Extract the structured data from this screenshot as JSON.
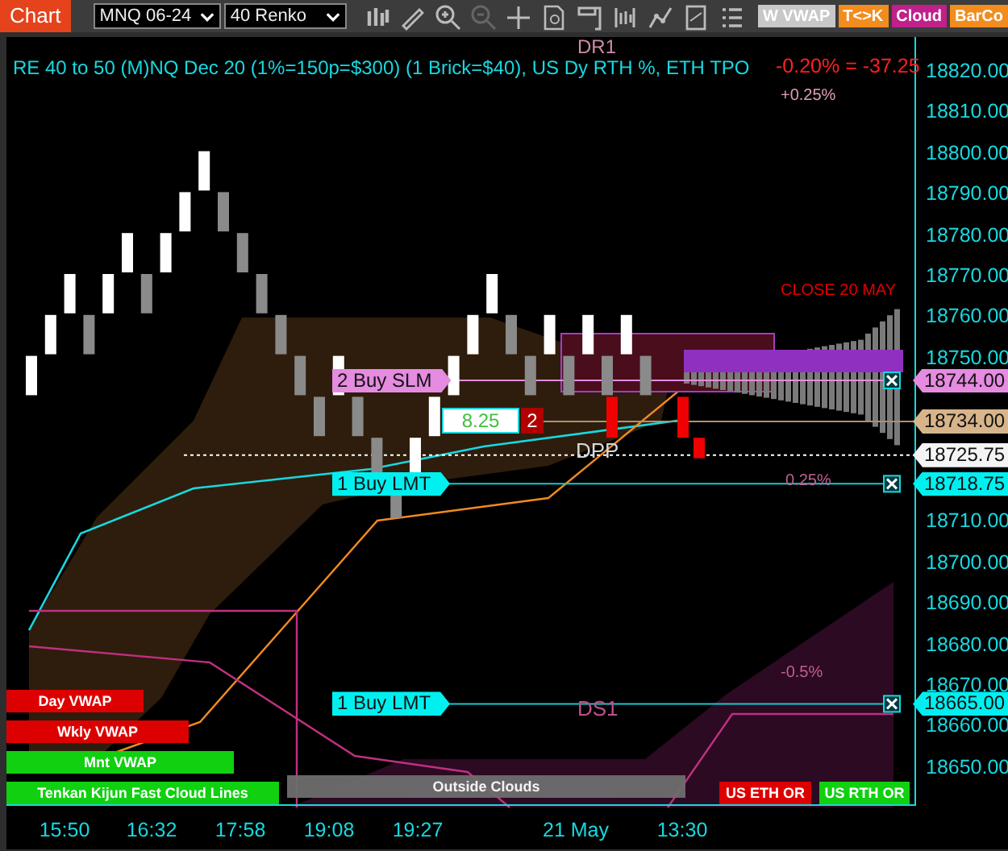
{
  "toolbar": {
    "chart_button": "Chart",
    "instrument": "MNQ 06-24",
    "bar_type": "40 Renko",
    "buttons": [
      {
        "label": "W VWAP",
        "color": "#c8c8c8"
      },
      {
        "label": "T<>K",
        "color": "#f28c1e"
      },
      {
        "label": "Cloud",
        "color": "#c0208a"
      },
      {
        "label": "BarCo",
        "color": "#f28c1e"
      }
    ]
  },
  "chart": {
    "title": "RE 40 to 50 (M)NQ Dec 20 (1%=150p=$300) (1 Brick=$40), US Dy RTH %, ETH TPO",
    "change": "-0.20% = -37.25",
    "annotations": [
      {
        "label": "DR1",
        "color": "#d08aa8"
      },
      {
        "label": "+0.25%",
        "color": "#e0a0b0"
      },
      {
        "label": "CLOSE 20 MAY",
        "color": "#e00000"
      },
      {
        "label": "DPP",
        "color": "#d8d8d8"
      },
      {
        "label": "0.25%",
        "color": "#c06090"
      },
      {
        "label": "-0.5%",
        "color": "#c06090"
      },
      {
        "label": "DS1",
        "color": "#c0508a"
      }
    ],
    "order_tags": [
      {
        "label": "2 Buy SLM",
        "color": "#e58be0"
      },
      {
        "label": "1 Buy LMT",
        "color": "#00f0f0"
      },
      {
        "label": "1 Buy LMT",
        "color": "#00f0f0"
      }
    ],
    "position": {
      "pnl": "8.25",
      "quantity": "2"
    },
    "legend_boxes": [
      {
        "label": "Day VWAP",
        "color": "#dd0000"
      },
      {
        "label": "Wkly VWAP",
        "color": "#dd0000"
      },
      {
        "label": "Mnt VWAP",
        "color": "#10d010"
      },
      {
        "label": "Tenkan Kijun Fast Cloud Lines",
        "color": "#10d010"
      },
      {
        "label": "Outside Clouds",
        "color": "#6e6e6e"
      },
      {
        "label": "US ETH OR",
        "color": "#dd0000"
      },
      {
        "label": "US RTH OR",
        "color": "#10d010"
      }
    ]
  },
  "price_axis": {
    "ticks": [
      "18820.00",
      "18810.00",
      "18800.00",
      "18790.00",
      "18780.00",
      "18770.00",
      "18760.00",
      "18750.00",
      "18710.00",
      "18700.00",
      "18690.00",
      "18680.00",
      "18670.00",
      "18660.00",
      "18650.00"
    ],
    "price_flags": [
      {
        "price": "18744.00",
        "color": "#e58be0"
      },
      {
        "price": "18734.00",
        "color": "#d7b48a"
      },
      {
        "price": "18725.75",
        "color": "#f4f4f4"
      },
      {
        "price": "18718.75",
        "color": "#00f0f0"
      },
      {
        "price": "18665.00",
        "color": "#00f0f0"
      }
    ]
  },
  "time_axis": {
    "labels": [
      "15:50",
      "16:32",
      "17:58",
      "19:08",
      "19:27",
      "21 May",
      "13:30"
    ]
  }
}
